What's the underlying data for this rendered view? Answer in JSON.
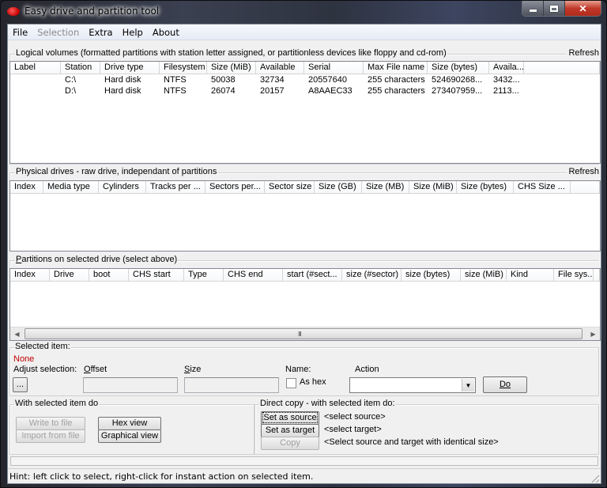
{
  "window": {
    "title": "Easy drive and partition tool",
    "icon": "red-disk-icon",
    "controls": {
      "minimize": "minimize-icon",
      "maximize": "maximize-icon",
      "close": "close-icon"
    }
  },
  "menu": [
    {
      "label": "File",
      "enabled": true
    },
    {
      "label": "Selection",
      "enabled": false
    },
    {
      "label": "Extra",
      "enabled": true
    },
    {
      "label": "Help",
      "enabled": true
    },
    {
      "label": "About",
      "enabled": true
    }
  ],
  "logical_volumes": {
    "title": "Logical volumes (formatted partitions with station letter assigned, or partitionless devices like floppy and cd-rom)",
    "refresh_label": "Refresh",
    "columns": [
      "Label",
      "Station",
      "Drive type",
      "Filesystem",
      "Size (MiB)",
      "Available",
      "Serial",
      "Max File name",
      "Size (bytes)",
      "Availa..."
    ],
    "rows": [
      [
        "",
        "C:\\",
        "Hard disk",
        "NTFS",
        "50038",
        "32734",
        "20557640",
        "255 characters",
        "524690268...",
        "3432..."
      ],
      [
        "",
        "D:\\",
        "Hard disk",
        "NTFS",
        "26074",
        "20157",
        "A8AAEC33",
        "255 characters",
        "273407959...",
        "2113..."
      ]
    ]
  },
  "physical_drives": {
    "title": "Physical drives - raw drive, independant of partitions",
    "refresh_label": "Refresh",
    "columns": [
      "Index",
      "Media type",
      "Cylinders",
      "Tracks per ...",
      "Sectors per...",
      "Sector size",
      "Size (GB)",
      "Size (MB)",
      "Size (MiB)",
      "Size (bytes)",
      "CHS Size ..."
    ],
    "rows": []
  },
  "partitions": {
    "title": "Partitions on selected drive (select above)",
    "columns": [
      "Index",
      "Drive",
      "boot",
      "CHS start",
      "Type",
      "CHS end",
      "start (#sect...",
      "size (#sector)",
      "size (bytes)",
      "size (MiB)",
      "Kind",
      "File sys..."
    ],
    "rows": [],
    "scrollbar_grip": "III"
  },
  "selected_item": {
    "title": "Selected item:",
    "value": "None",
    "value_color": "#c00000",
    "adjust_label": "Adjust selection:",
    "adjust_button": "...",
    "offset_label": "Offset",
    "offset_value": "",
    "size_label": "Size",
    "size_value": "",
    "name_label": "Name:",
    "as_hex_label": "As hex",
    "as_hex_checked": false,
    "action_label": "Action",
    "action_value": "",
    "do_button": "Do"
  },
  "with_selected": {
    "title": "With selected item do",
    "write_to_file": "Write to file",
    "import_from_file": "Import from file",
    "hex_view": "Hex view",
    "graphical_view": "Graphical view"
  },
  "direct_copy": {
    "title": "Direct copy - with selected item do:",
    "set_source": "Set as source",
    "set_target": "Set as target",
    "copy": "Copy",
    "source_status": "<select source>",
    "target_status": "<select target>",
    "copy_status": "<Select source and target with identical size>"
  },
  "status_bar": {
    "hint": "Hint: left click to select, right-click for instant action on selected item."
  }
}
